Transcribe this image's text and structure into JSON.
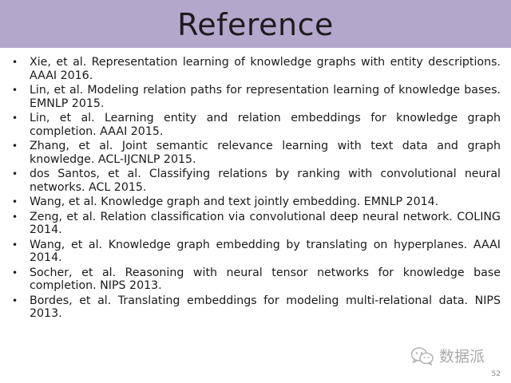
{
  "slide": {
    "title": "Reference",
    "page_number": "52",
    "watermark": {
      "text": "数据派",
      "icon": "wechat-icon"
    }
  },
  "colors": {
    "header_band": "#b3a7cc",
    "text": "#1a1a1a",
    "watermark": "#aaaaaa"
  },
  "references": [
    {
      "bullet": "•",
      "text": "Xie, et al. Representation learning of knowledge graphs with entity descriptions. AAAI 2016."
    },
    {
      "bullet": "•",
      "text": "Lin, et al. Modeling relation paths for representation learning of knowledge bases. EMNLP 2015."
    },
    {
      "bullet": "•",
      "text": "Lin, et al. Learning entity and relation embeddings for knowledge graph completion. AAAI 2015."
    },
    {
      "bullet": "•",
      "text": "Zhang, et al. Joint semantic relevance learning with text data and graph knowledge. ACL-IJCNLP 2015."
    },
    {
      "bullet": "•",
      "text": "dos Santos, et al. Classifying relations by ranking with convolutional neural networks. ACL 2015."
    },
    {
      "bullet": "•",
      "text": "Wang, et al. Knowledge graph and text jointly embedding. EMNLP 2014."
    },
    {
      "bullet": "•",
      "text": "Zeng, et al. Relation classification via convolutional deep neural network. COLING 2014."
    },
    {
      "bullet": "•",
      "text": "Wang, et al. Knowledge graph embedding by translating on hyperplanes. AAAI 2014."
    },
    {
      "bullet": "•",
      "text": "Socher, et al. Reasoning with neural tensor networks for knowledge base completion. NIPS 2013."
    },
    {
      "bullet": "•",
      "text": "Bordes, et al. Translating embeddings for modeling multi-relational data. NIPS 2013."
    }
  ]
}
